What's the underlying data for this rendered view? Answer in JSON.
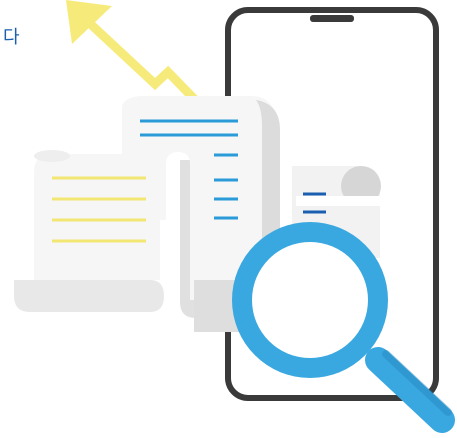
{
  "corner_text": "다",
  "colors": {
    "phone_frame": "#3a3a3a",
    "paper": "#f6f6f6",
    "paper_shadow": "#d9d9d9",
    "line_yellow": "#f3e774",
    "line_blue": "#2a9ad8",
    "line_dark_blue": "#1b5fb0",
    "arrow_yellow": "#f6eb7a",
    "magnifier_ring": "#3aa8e0"
  },
  "icons": [
    "trend-arrow-icon",
    "smartphone-icon",
    "receipt-icon",
    "magnifier-icon"
  ]
}
